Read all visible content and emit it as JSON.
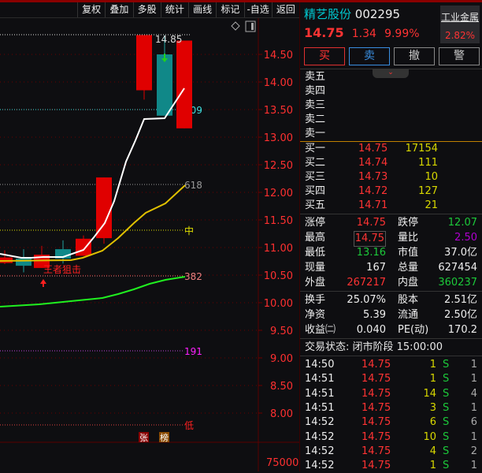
{
  "toolbar": [
    "复权",
    "叠加",
    "多股",
    "统计",
    "画线",
    "标记",
    "-自选",
    "返回"
  ],
  "chart": {
    "y_ticks": [
      "14.50",
      "14.00",
      "13.50",
      "13.00",
      "12.50",
      "12.00",
      "11.50",
      "11.00",
      "10.50",
      "10.00",
      "9.50",
      "9.00",
      "8.50",
      "8.00"
    ],
    "y_tick_values": [
      14.5,
      14.0,
      13.5,
      13.0,
      12.5,
      12.0,
      11.5,
      11.0,
      10.5,
      10.0,
      9.5,
      9.0,
      8.5,
      8.0
    ],
    "high_label": "14.85",
    "fib_809": "809",
    "fib_618": "618",
    "fib_mid": "中",
    "fib_382": "382",
    "fib_191": "191",
    "fib_low": "低",
    "signal_label": "王者狙击",
    "badge_zhang": "张",
    "badge_bang": "榜",
    "volume_tick": "75000",
    "candles": [
      {
        "o": 10.72,
        "c": 10.82,
        "h": 10.95,
        "l": 10.7
      },
      {
        "o": 10.8,
        "c": 10.67,
        "h": 10.97,
        "l": 10.55
      },
      {
        "o": 10.63,
        "c": 10.87,
        "h": 11.03,
        "l": 10.63
      },
      {
        "o": 10.97,
        "c": 10.8,
        "h": 11.13,
        "l": 10.71
      },
      {
        "o": 10.85,
        "c": 11.16,
        "h": 11.22,
        "l": 10.85
      },
      {
        "o": 11.17,
        "c": 12.27,
        "h": 12.27,
        "l": 11.07
      },
      {
        "o": 13.85,
        "c": 14.85,
        "h": 14.85,
        "l": 13.68
      },
      {
        "o": 14.5,
        "c": 13.39,
        "h": 14.85,
        "l": 13.39
      },
      {
        "o": 13.16,
        "c": 14.75,
        "h": 14.75,
        "l": 13.16
      }
    ]
  },
  "stock": {
    "name": "精艺股份",
    "code": "002295",
    "price": "14.75",
    "change": "1.34",
    "pct": "9.99%",
    "sector": "工业金属",
    "sector_pct": "2.82%"
  },
  "buttons": {
    "buy": "买",
    "sell": "卖",
    "cancel": "撤",
    "alert": "警"
  },
  "asks": [
    "卖五",
    "卖四",
    "卖三",
    "卖二",
    "卖一"
  ],
  "bids": [
    {
      "label": "买一",
      "price": "14.75",
      "vol": "17154"
    },
    {
      "label": "买二",
      "price": "14.74",
      "vol": "111"
    },
    {
      "label": "买三",
      "price": "14.73",
      "vol": "10"
    },
    {
      "label": "买四",
      "price": "14.72",
      "vol": "127"
    },
    {
      "label": "买五",
      "price": "14.71",
      "vol": "21"
    }
  ],
  "stats": [
    {
      "l1": "涨停",
      "v1": "14.75",
      "c1": "red",
      "l2": "跌停",
      "v2": "12.07",
      "c2": "green"
    },
    {
      "l1": "最高",
      "v1": "14.75",
      "c1": "red",
      "l2": "量比",
      "v2": "2.50",
      "c2": "purple"
    },
    {
      "l1": "最低",
      "v1": "13.16",
      "c1": "green",
      "l2": "市值",
      "v2": "37.0亿",
      "c2": "white"
    },
    {
      "l1": "现量",
      "v1": "167",
      "c1": "white",
      "l2": "总量",
      "v2": "627454",
      "c2": "white"
    },
    {
      "l1": "外盘",
      "v1": "267217",
      "c1": "red",
      "l2": "内盘",
      "v2": "360237",
      "c2": "green"
    }
  ],
  "stats2": [
    {
      "l1": "换手",
      "v1": "25.07%",
      "l2": "股本",
      "v2": "2.51亿"
    },
    {
      "l1": "净资",
      "v1": "5.39",
      "l2": "流通",
      "v2": "2.50亿"
    },
    {
      "l1": "收益㈡",
      "v1": "0.040",
      "l2": "PE(动)",
      "v2": "170.2"
    }
  ],
  "status": "交易状态: 闭市阶段 15:00:00",
  "ticks": [
    {
      "t": "14:50",
      "p": "14.75",
      "v": "1",
      "s": "S",
      "n": "1"
    },
    {
      "t": "14:51",
      "p": "14.75",
      "v": "1",
      "s": "S",
      "n": "1"
    },
    {
      "t": "14:51",
      "p": "14.75",
      "v": "14",
      "s": "S",
      "n": "4"
    },
    {
      "t": "14:51",
      "p": "14.75",
      "v": "3",
      "s": "S",
      "n": "1"
    },
    {
      "t": "14:52",
      "p": "14.75",
      "v": "6",
      "s": "S",
      "n": "6"
    },
    {
      "t": "14:52",
      "p": "14.75",
      "v": "10",
      "s": "S",
      "n": "1"
    },
    {
      "t": "14:52",
      "p": "14.75",
      "v": "4",
      "s": "S",
      "n": "2"
    },
    {
      "t": "14:52",
      "p": "14.75",
      "v": "1",
      "s": "S",
      "n": "1"
    }
  ],
  "colors": {
    "up": "#ff2020",
    "down": "#1aa0a0",
    "accent": "#00c8d0"
  }
}
